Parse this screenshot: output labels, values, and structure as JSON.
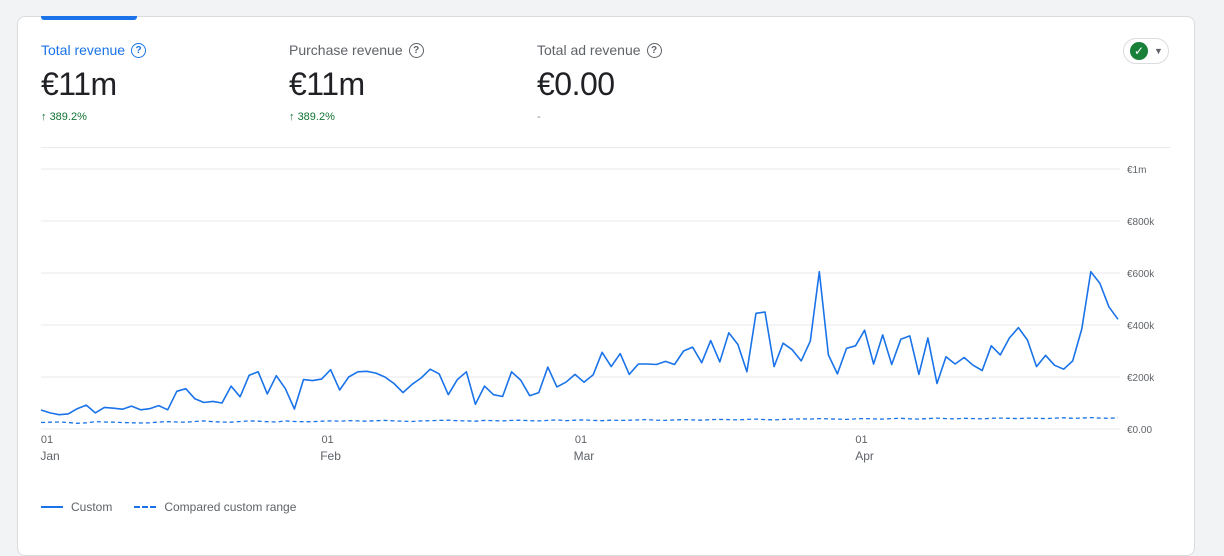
{
  "metrics": [
    {
      "label": "Total revenue",
      "value": "€11m",
      "change": "389.2%",
      "change_arrow": "↑"
    },
    {
      "label": "Purchase revenue",
      "value": "€11m",
      "change": "389.2%",
      "change_arrow": "↑"
    },
    {
      "label": "Total ad revenue",
      "value": "€0.00",
      "change": "-"
    }
  ],
  "help_glyph": "?",
  "status": {
    "glyph": "✓",
    "caret": "▼"
  },
  "legend": {
    "custom": "Custom",
    "compared": "Compared custom range"
  },
  "colors": {
    "accent": "#1a73e8",
    "positive": "#137333",
    "status_ok": "#188038",
    "grid": "#e8eaed"
  },
  "chart_data": {
    "type": "line",
    "x_start": "2023-01-01",
    "x_ticks": [
      {
        "date": "2023-01-01",
        "day": "01",
        "month": "Jan"
      },
      {
        "date": "2023-02-01",
        "day": "01",
        "month": "Feb"
      },
      {
        "date": "2023-03-01",
        "day": "01",
        "month": "Mar"
      },
      {
        "date": "2023-04-01",
        "day": "01",
        "month": "Apr"
      }
    ],
    "ylim": [
      0,
      1000000
    ],
    "y_ticks": [
      {
        "value": 0,
        "label": "€0.00"
      },
      {
        "value": 200000,
        "label": "€200k"
      },
      {
        "value": 400000,
        "label": "€400k"
      },
      {
        "value": 600000,
        "label": "€600k"
      },
      {
        "value": 800000,
        "label": "€800k"
      },
      {
        "value": 1000000,
        "label": "€1m"
      }
    ],
    "grid": true,
    "legend_position": "bottom-left",
    "series": [
      {
        "name": "Custom",
        "style": "solid",
        "values": [
          73000,
          62000,
          55000,
          58000,
          78000,
          92000,
          62000,
          83000,
          80000,
          76000,
          88000,
          74000,
          78000,
          90000,
          74000,
          145000,
          155000,
          116000,
          102000,
          106000,
          100000,
          165000,
          124000,
          207000,
          220000,
          135000,
          205000,
          155000,
          77000,
          190000,
          186000,
          192000,
          228000,
          150000,
          200000,
          220000,
          222000,
          215000,
          200000,
          175000,
          140000,
          172000,
          196000,
          230000,
          212000,
          132000,
          190000,
          220000,
          95000,
          165000,
          132000,
          125000,
          220000,
          188000,
          128000,
          140000,
          238000,
          162000,
          180000,
          210000,
          180000,
          208000,
          295000,
          240000,
          290000,
          210000,
          250000,
          250000,
          248000,
          260000,
          248000,
          300000,
          315000,
          255000,
          340000,
          258000,
          370000,
          325000,
          220000,
          445000,
          450000,
          240000,
          330000,
          305000,
          262000,
          338000,
          605000,
          285000,
          212000,
          310000,
          320000,
          380000,
          250000,
          362000,
          248000,
          345000,
          358000,
          210000,
          350000,
          175000,
          278000,
          250000,
          275000,
          245000,
          225000,
          320000,
          285000,
          350000,
          390000,
          342000,
          240000,
          283000,
          245000,
          230000,
          262000,
          385000,
          605000,
          560000,
          470000,
          422000
        ]
      },
      {
        "name": "Compared custom range",
        "style": "dashed",
        "values": [
          25000,
          26000,
          27000,
          25000,
          22000,
          24000,
          28000,
          27000,
          26000,
          25000,
          24000,
          23000,
          24000,
          27000,
          28000,
          27000,
          26000,
          29000,
          31000,
          28000,
          27000,
          26000,
          29000,
          31000,
          30000,
          28000,
          27000,
          31000,
          29000,
          28000,
          28000,
          30000,
          31000,
          30000,
          32000,
          31000,
          30000,
          32000,
          33000,
          31000,
          30000,
          29000,
          31000,
          32000,
          33000,
          34000,
          32000,
          31000,
          30000,
          33000,
          32000,
          31000,
          33000,
          34000,
          32000,
          31000,
          33000,
          35000,
          32000,
          34000,
          35000,
          33000,
          32000,
          34000,
          33000,
          34000,
          35000,
          36000,
          34000,
          33000,
          35000,
          36000,
          35000,
          34000,
          36000,
          37000,
          36000,
          35000,
          37000,
          38000,
          36000,
          35000,
          37000,
          38000,
          39000,
          38000,
          40000,
          39000,
          38000,
          37000,
          39000,
          40000,
          39000,
          38000,
          40000,
          41000,
          39000,
          38000,
          40000,
          42000,
          40000,
          39000,
          41000,
          40000,
          39000,
          41000,
          42000,
          41000,
          40000,
          42000,
          41000,
          40000,
          42000,
          43000,
          41000,
          42000,
          44000,
          42000,
          41000,
          43000
        ]
      }
    ]
  }
}
